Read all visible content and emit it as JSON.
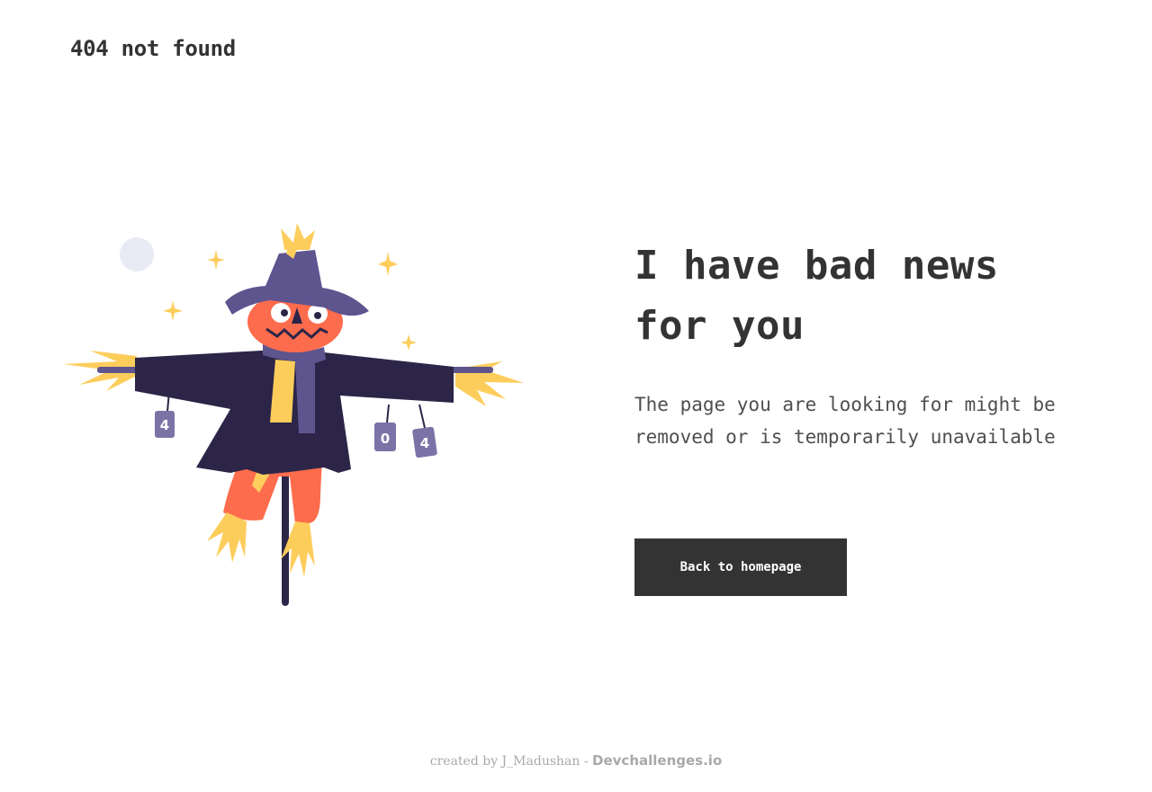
{
  "header": {
    "logo_text": "404 not found"
  },
  "main": {
    "headline_line1": "I have bad news",
    "headline_line2": "for you",
    "message": "The page you are looking for might be removed or is temporarily unavailable",
    "button_label": "Back to homepage"
  },
  "illustration": {
    "cans": [
      "4",
      "0",
      "4"
    ],
    "colors": {
      "hat": "#5e548e",
      "coat": "#2c2548",
      "pumpkin": "#fd6c4c",
      "straw": "#fdcd5c",
      "moon": "#e8eaf4"
    }
  },
  "footer": {
    "credit_text": "created by J_Madushan - ",
    "brand_text": "Devchallenges.io"
  }
}
